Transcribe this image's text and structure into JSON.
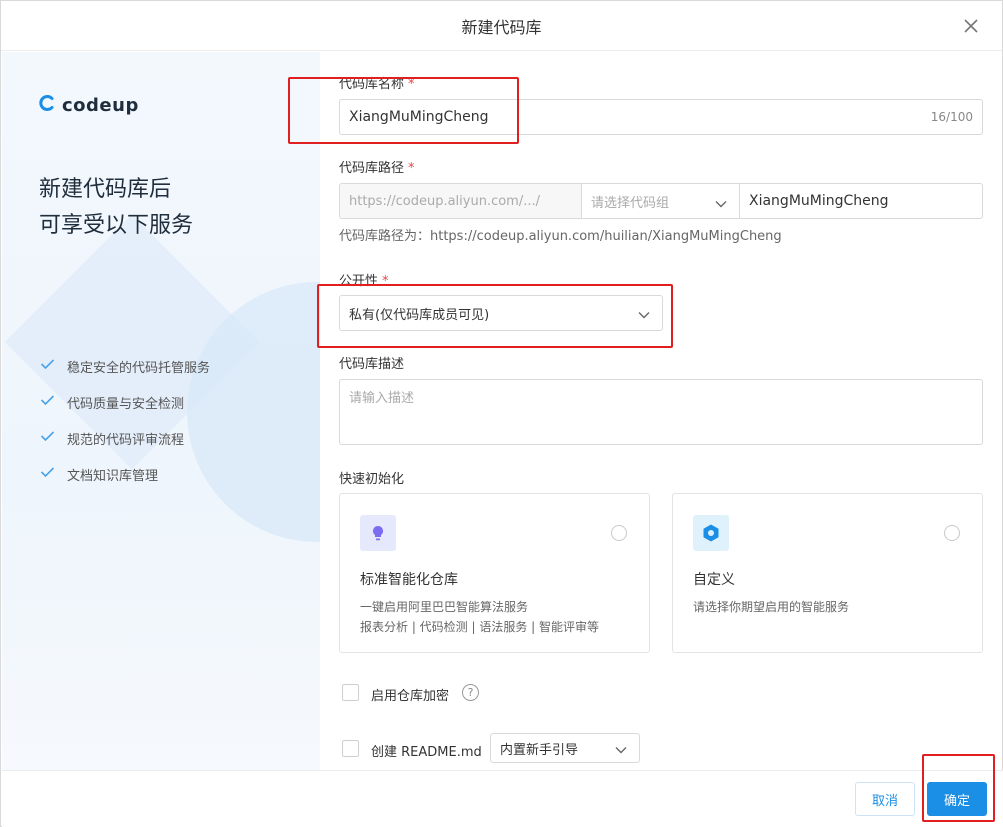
{
  "dialog": {
    "title": "新建代码库"
  },
  "brand": {
    "name": "codeup"
  },
  "promo": {
    "headline_line1": "新建代码库后",
    "headline_line2": "可享受以下服务",
    "features": [
      "稳定安全的代码托管服务",
      "代码质量与安全检测",
      "规范的代码评审流程",
      "文档知识库管理"
    ]
  },
  "form": {
    "name": {
      "label": "代码库名称",
      "required_mark": "*",
      "value": "XiangMuMingCheng",
      "count": "16/100"
    },
    "path": {
      "label": "代码库路径",
      "required_mark": "*",
      "prefix": "https://codeup.aliyun.com/.../",
      "group_placeholder": "请选择代码组",
      "value": "XiangMuMingCheng",
      "hint": "代码库路径为：https://codeup.aliyun.com/huilian/XiangMuMingCheng"
    },
    "visibility": {
      "label": "公开性",
      "required_mark": "*",
      "value": "私有(仅代码库成员可见)"
    },
    "description": {
      "label": "代码库描述",
      "placeholder": "请输入描述"
    },
    "quick_init": {
      "label": "快速初始化",
      "cards": [
        {
          "title": "标准智能化仓库",
          "desc_line1": "一键启用阿里巴巴智能算法服务",
          "desc_line2": "报表分析 | 代码检测 | 语法服务 | 智能评审等",
          "icon": "lightbulb-icon"
        },
        {
          "title": "自定义",
          "desc_line1": "请选择你期望启用的智能服务",
          "desc_line2": "",
          "icon": "hexagon-icon"
        }
      ]
    },
    "encryption": {
      "label": "启用仓库加密",
      "help": "?"
    },
    "readme": {
      "label": "创建 README.md",
      "template": "内置新手引导"
    }
  },
  "footer": {
    "cancel_label": "取消",
    "ok_label": "确定"
  },
  "colors": {
    "primary": "#1b8fe6",
    "annotation": "#e02020",
    "required": "#e64545"
  }
}
